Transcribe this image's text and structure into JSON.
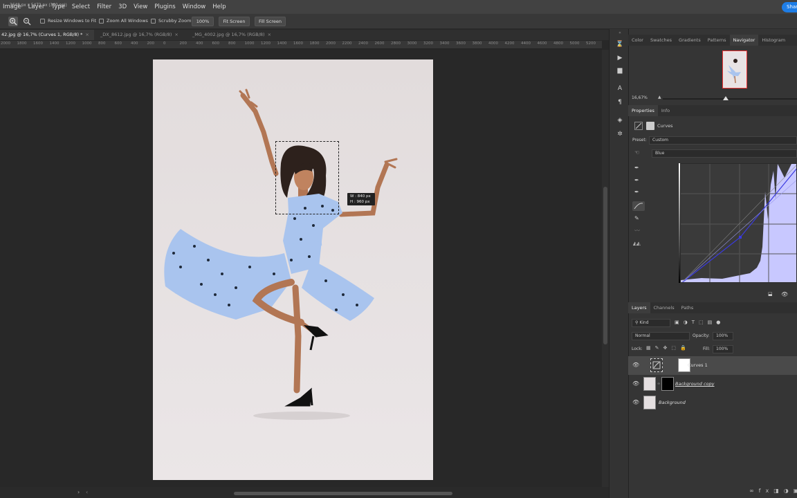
{
  "menubar": {
    "items": [
      "Image",
      "Layer",
      "Type",
      "Select",
      "Filter",
      "3D",
      "View",
      "Plugins",
      "Window",
      "Help"
    ],
    "share_label": "Shar"
  },
  "options": {
    "resize_windows": "Resize Windows to Fit",
    "zoom_all": "Zoom All Windows",
    "scrubby": "Scrubby Zoom",
    "zoom_100": "100%",
    "fit_screen": "Fit Screen",
    "fill_screen": "Fill Screen"
  },
  "tabs": [
    {
      "label": "42.jpg @ 16,7% (Curves 1, RGB/8) *"
    },
    {
      "label": "_DX_8612.jpg @ 16,7% (RGB/8)"
    },
    {
      "label": "_MG_4002.jpg @ 16,7% (RGB/8)"
    }
  ],
  "ruler": [
    "2000",
    "1800",
    "1600",
    "1400",
    "1200",
    "1000",
    "800",
    "600",
    "400",
    "200",
    "0",
    "200",
    "400",
    "600",
    "800",
    "1000",
    "1200",
    "1400",
    "1600",
    "1800",
    "2000",
    "2200",
    "2400",
    "2600",
    "2800",
    "3000",
    "3200",
    "3400",
    "3600",
    "3800",
    "4000",
    "4200",
    "4400",
    "4600",
    "4800",
    "5000",
    "5200",
    "54"
  ],
  "hud": {
    "w": "W : 840 px",
    "h": "H : 960 px"
  },
  "status": {
    "text": "3648 px x 5472 px (300 ppi)"
  },
  "panel_tabs_top": [
    "Color",
    "Swatches",
    "Gradients",
    "Patterns",
    "Navigator",
    "Histogram"
  ],
  "navigator": {
    "zoom": "16,67%"
  },
  "properties": {
    "tabs": [
      "Properties",
      "Info"
    ],
    "adjustment": "Curves",
    "preset_label": "Preset:",
    "preset_value": "Custom",
    "channel": "Blue"
  },
  "layers": {
    "tabs": [
      "Layers",
      "Channels",
      "Paths"
    ],
    "kind": "Kind",
    "blend": "Normal",
    "opacity_label": "Opacity:",
    "opacity": "100%",
    "lock_label": "Lock:",
    "fill_label": "Fill:",
    "fill": "100%",
    "rows": [
      {
        "name": "Curves 1"
      },
      {
        "name": "Background copy"
      },
      {
        "name": "Background"
      }
    ]
  },
  "colors": {
    "accent": "#1e7de6",
    "curve_channel": "#3a3ae0",
    "histogram": "#c8c8ff"
  }
}
